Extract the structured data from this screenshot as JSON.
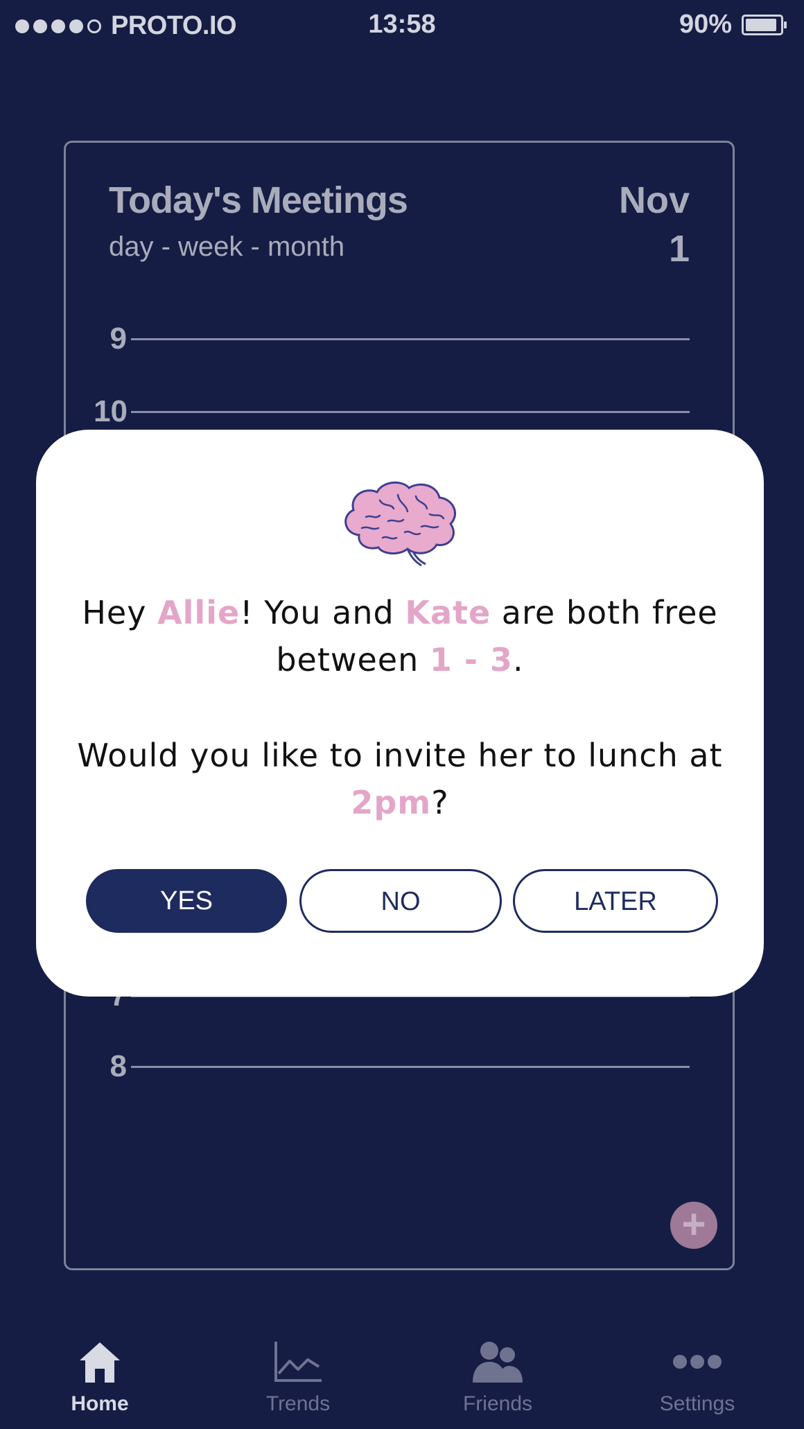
{
  "status_bar": {
    "carrier": "PROTO.IO",
    "time": "13:58",
    "battery": "90%"
  },
  "calendar": {
    "title": "Today's Meetings",
    "view_options": [
      "day",
      "week",
      "month"
    ],
    "separator": " - ",
    "month": "Nov",
    "day": "1",
    "hours_top": [
      "9",
      "10"
    ],
    "hours_bottom": [
      "7",
      "8"
    ],
    "add_symbol": "+"
  },
  "modal": {
    "line1_pre": "Hey ",
    "user_name": "Allie",
    "line1_mid": "! You and ",
    "friend_name": "Kate",
    "line1_post": " are both free between ",
    "time_range": "1 - 3",
    "line1_end": ".",
    "line2_pre": "Would you like to invite her to lunch at ",
    "suggested_time": "2pm",
    "line2_end": "?",
    "buttons": {
      "yes": "YES",
      "no": "NO",
      "later": "LATER"
    },
    "icon": "brain-icon",
    "brain_color": "#e8aacd"
  },
  "tab_bar": {
    "tabs": [
      {
        "label": "Home",
        "icon": "home-icon",
        "active": true
      },
      {
        "label": "Trends",
        "icon": "trends-icon",
        "active": false
      },
      {
        "label": "Friends",
        "icon": "friends-icon",
        "active": false
      },
      {
        "label": "Settings",
        "icon": "more-icon",
        "active": false
      }
    ]
  },
  "colors": {
    "background": "#161d44",
    "accent_pink": "#e4a6c8",
    "button_navy": "#1e2b5f"
  }
}
